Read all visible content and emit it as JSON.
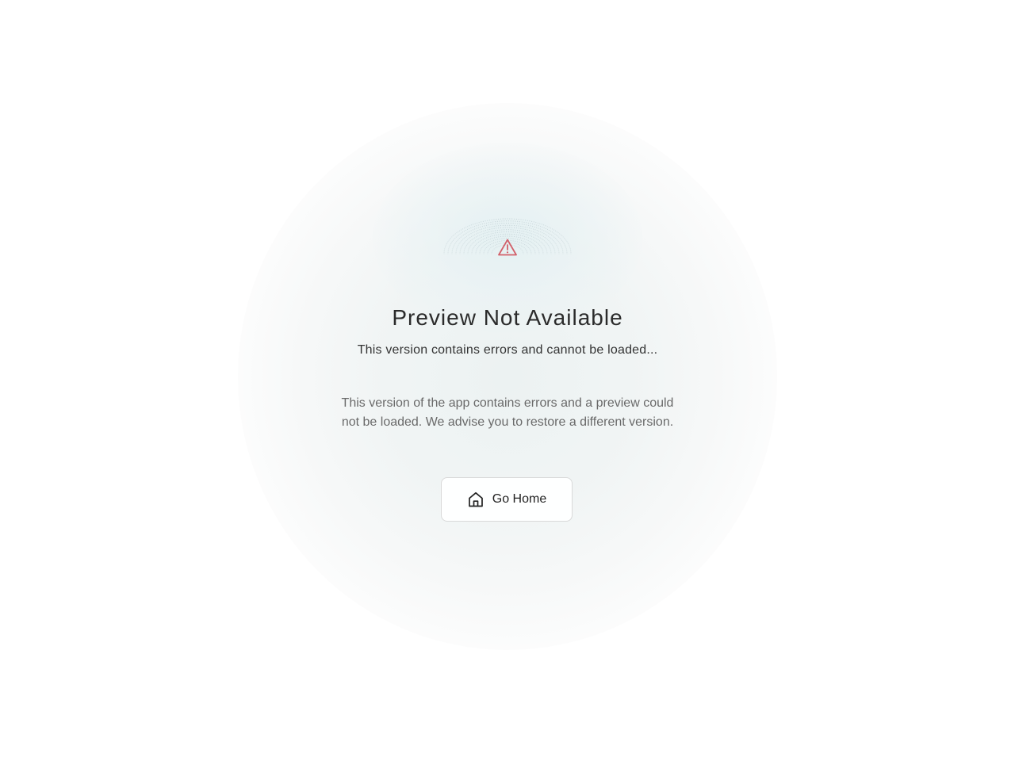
{
  "error": {
    "title": "Preview Not Available",
    "subtitle": "This version contains errors and cannot be loaded...",
    "description": "This version of the app contains errors and a preview could not be loaded. We advise you to restore a different version.",
    "icon": "warning-triangle-icon",
    "icon_color": "#d2606a"
  },
  "actions": {
    "home_label": "Go Home",
    "home_icon": "home-icon"
  }
}
